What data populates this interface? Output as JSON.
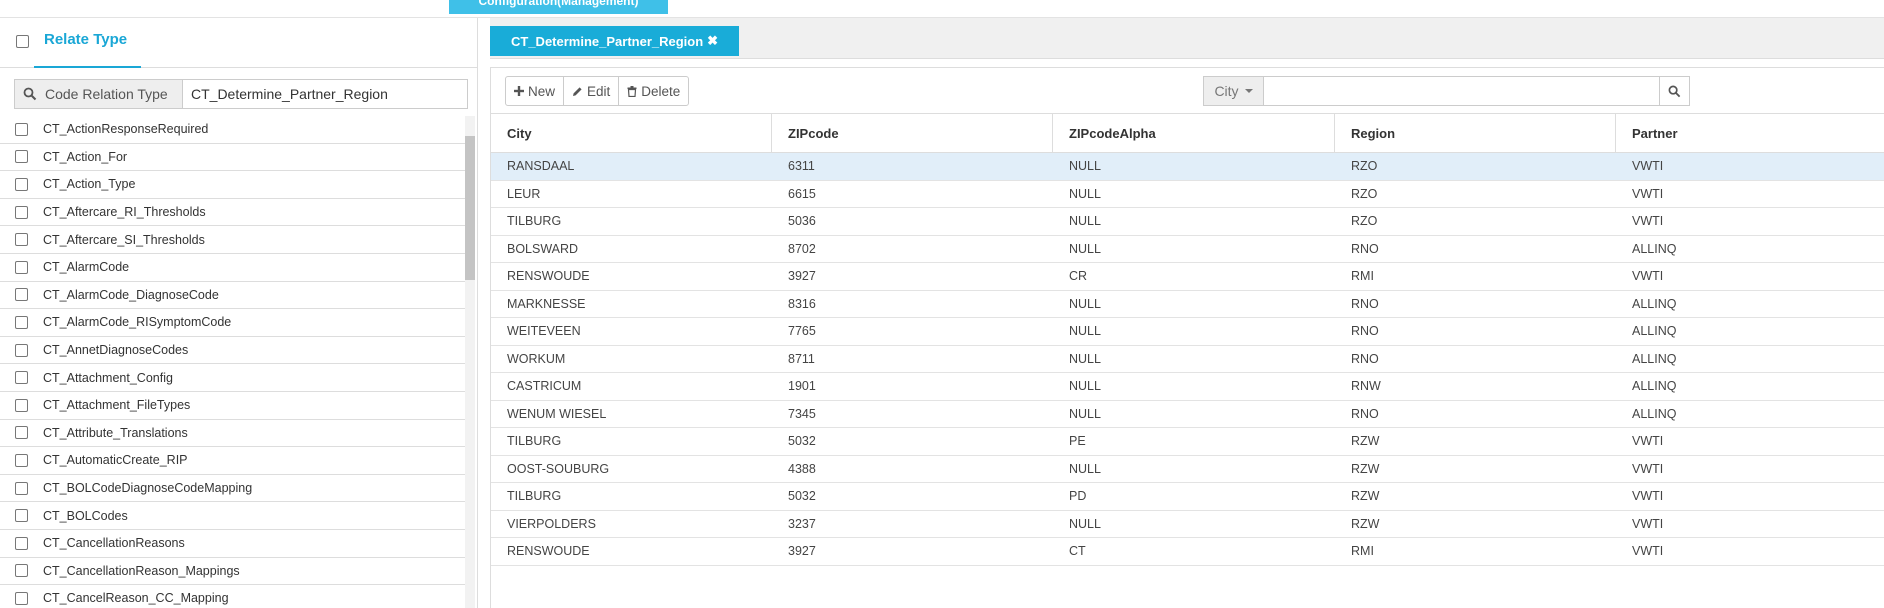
{
  "top_tab": {
    "label": "Configuration(Management)"
  },
  "left_panel": {
    "tab_label": "Relate Type",
    "search": {
      "addon_label": "Code Relation Type",
      "value": "CT_Determine_Partner_Region"
    },
    "items": [
      "CT_ActionResponseRequired",
      "CT_Action_For",
      "CT_Action_Type",
      "CT_Aftercare_RI_Thresholds",
      "CT_Aftercare_SI_Thresholds",
      "CT_AlarmCode",
      "CT_AlarmCode_DiagnoseCode",
      "CT_AlarmCode_RISymptomCode",
      "CT_AnnetDiagnoseCodes",
      "CT_Attachment_Config",
      "CT_Attachment_FileTypes",
      "CT_Attribute_Translations",
      "CT_AutomaticCreate_RIP",
      "CT_BOLCodeDiagnoseCodeMapping",
      "CT_BOLCodes",
      "CT_CancellationReasons",
      "CT_CancellationReason_Mappings",
      "CT_CancelReason_CC_Mapping"
    ]
  },
  "right_panel": {
    "active_tab": {
      "label": "CT_Determine_Partner_Region",
      "close_glyph": "✖"
    },
    "toolbar": {
      "new_label": "New",
      "edit_label": "Edit",
      "delete_label": "Delete"
    },
    "filter": {
      "field": "City",
      "value": ""
    },
    "grid": {
      "columns": [
        "City",
        "ZIPcode",
        "ZIPcodeAlpha",
        "Region",
        "Partner"
      ],
      "rows": [
        [
          "RANSDAAL",
          "6311",
          "NULL",
          "RZO",
          "VWTI"
        ],
        [
          "LEUR",
          "6615",
          "NULL",
          "RZO",
          "VWTI"
        ],
        [
          "TILBURG",
          "5036",
          "NULL",
          "RZO",
          "VWTI"
        ],
        [
          "BOLSWARD",
          "8702",
          "NULL",
          "RNO",
          "ALLINQ"
        ],
        [
          "RENSWOUDE",
          "3927",
          "CR",
          "RMI",
          "VWTI"
        ],
        [
          "MARKNESSE",
          "8316",
          "NULL",
          "RNO",
          "ALLINQ"
        ],
        [
          "WEITEVEEN",
          "7765",
          "NULL",
          "RNO",
          "ALLINQ"
        ],
        [
          "WORKUM",
          "8711",
          "NULL",
          "RNO",
          "ALLINQ"
        ],
        [
          "CASTRICUM",
          "1901",
          "NULL",
          "RNW",
          "ALLINQ"
        ],
        [
          "WENUM WIESEL",
          "7345",
          "NULL",
          "RNO",
          "ALLINQ"
        ],
        [
          "TILBURG",
          "5032",
          "PE",
          "RZW",
          "VWTI"
        ],
        [
          "OOST-SOUBURG",
          "4388",
          "NULL",
          "RZW",
          "VWTI"
        ],
        [
          "TILBURG",
          "5032",
          "PD",
          "RZW",
          "VWTI"
        ],
        [
          "VIERPOLDERS",
          "3237",
          "NULL",
          "RZW",
          "VWTI"
        ],
        [
          "RENSWOUDE",
          "3927",
          "CT",
          "RMI",
          "VWTI"
        ]
      ],
      "selected_row": 0
    }
  },
  "colors": {
    "accent": "#19acd8",
    "selected_row": "#e1eef9"
  }
}
